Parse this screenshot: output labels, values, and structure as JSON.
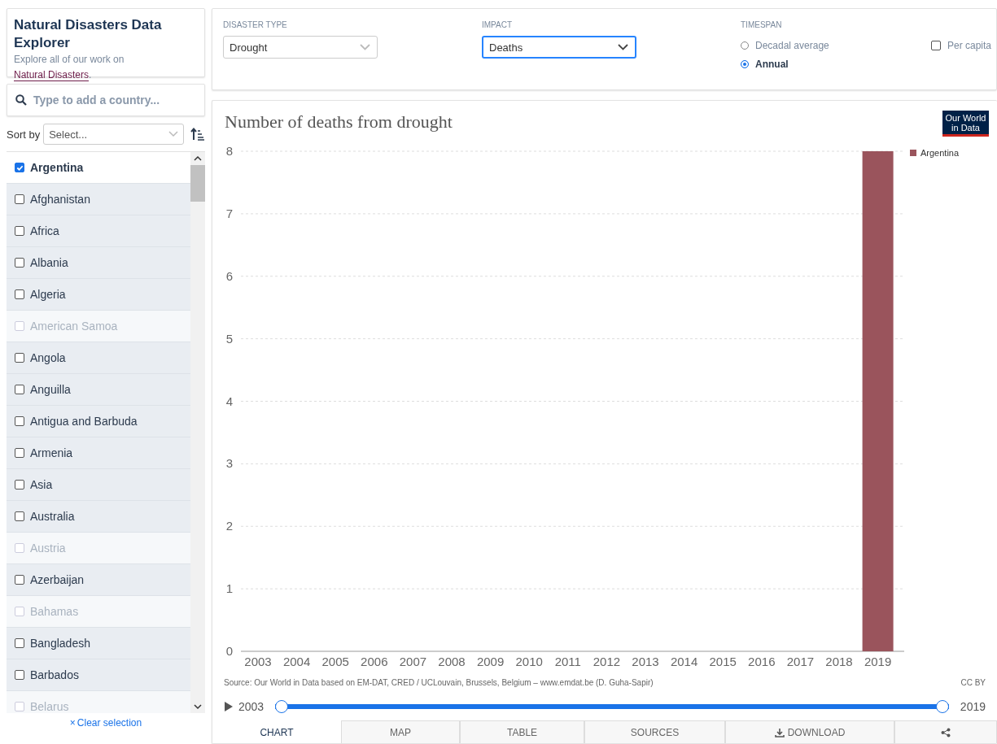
{
  "header": {
    "title": "Natural Disasters Data Explorer",
    "subtitle": {
      "text": "Explore all of our work on",
      "link": "Natural Disasters",
      "after": "."
    }
  },
  "controls": {
    "selects": [
      {
        "label": "DISASTER TYPE",
        "value": "Drought",
        "focused": false
      },
      {
        "label": "IMPACT",
        "value": "Deaths",
        "focused": true
      }
    ],
    "timespan": {
      "label": "TIMESPAN",
      "options": [
        {
          "label": "Decadal average",
          "selected": false
        },
        {
          "label": "Annual",
          "selected": true
        }
      ]
    },
    "per_capita": {
      "label": "Per capita",
      "checked": false
    }
  },
  "search": {
    "placeholder": "Type to add a country..."
  },
  "sort": {
    "label": "Sort by",
    "placeholder": "Select..."
  },
  "countries": [
    {
      "name": "Argentina",
      "checked": true,
      "disabled": false
    },
    {
      "name": "Afghanistan",
      "checked": false,
      "disabled": false
    },
    {
      "name": "Africa",
      "checked": false,
      "disabled": false
    },
    {
      "name": "Albania",
      "checked": false,
      "disabled": false
    },
    {
      "name": "Algeria",
      "checked": false,
      "disabled": false
    },
    {
      "name": "American Samoa",
      "checked": false,
      "disabled": true
    },
    {
      "name": "Angola",
      "checked": false,
      "disabled": false
    },
    {
      "name": "Anguilla",
      "checked": false,
      "disabled": false
    },
    {
      "name": "Antigua and Barbuda",
      "checked": false,
      "disabled": false
    },
    {
      "name": "Armenia",
      "checked": false,
      "disabled": false
    },
    {
      "name": "Asia",
      "checked": false,
      "disabled": false
    },
    {
      "name": "Australia",
      "checked": false,
      "disabled": false
    },
    {
      "name": "Austria",
      "checked": false,
      "disabled": true
    },
    {
      "name": "Azerbaijan",
      "checked": false,
      "disabled": false
    },
    {
      "name": "Bahamas",
      "checked": false,
      "disabled": true
    },
    {
      "name": "Bangladesh",
      "checked": false,
      "disabled": false
    },
    {
      "name": "Barbados",
      "checked": false,
      "disabled": false
    },
    {
      "name": "Belarus",
      "checked": false,
      "disabled": true
    }
  ],
  "clear_selection": {
    "icon": "×",
    "label": "Clear selection"
  },
  "chart": {
    "logo": [
      "Our World",
      "in Data"
    ],
    "chart_data": {
      "type": "bar",
      "title": "Number of deaths from drought",
      "categories": [
        "2003",
        "2004",
        "2005",
        "2006",
        "2007",
        "2008",
        "2009",
        "2010",
        "2011",
        "2012",
        "2013",
        "2014",
        "2015",
        "2016",
        "2017",
        "2018",
        "2019"
      ],
      "series": [
        {
          "name": "Argentina",
          "color": "#9a545c",
          "values": [
            null,
            null,
            null,
            null,
            null,
            null,
            null,
            null,
            null,
            null,
            null,
            null,
            null,
            null,
            null,
            null,
            8
          ]
        }
      ],
      "ylim": [
        0,
        8
      ],
      "grid": true,
      "yticks": [
        0,
        1,
        2,
        3,
        4,
        5,
        6,
        7,
        8
      ]
    },
    "source": "Source: Our World in Data based on EM-DAT, CRED / UCLouvain, Brussels, Belgium – www.emdat.be (D. Guha-Sapir)",
    "license": "CC BY",
    "timeline": {
      "start": "2003",
      "end": "2019",
      "level": 1
    }
  },
  "tabs": [
    {
      "label": "CHART",
      "kind": "text",
      "selected": true
    },
    {
      "label": "MAP",
      "kind": "text",
      "selected": false
    },
    {
      "label": "TABLE",
      "kind": "text",
      "selected": false
    },
    {
      "label": "SOURCES",
      "kind": "text",
      "selected": false
    },
    {
      "label": "DOWNLOAD",
      "kind": "download",
      "selected": false
    },
    {
      "kind": "share",
      "selected": false
    }
  ]
}
